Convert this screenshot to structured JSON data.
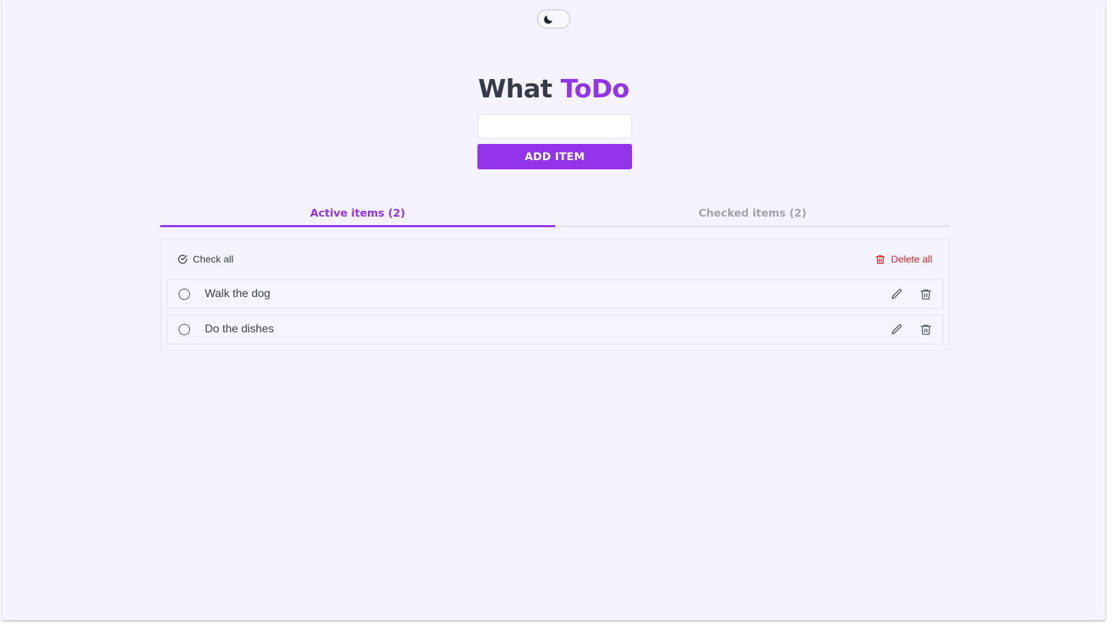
{
  "header": {
    "theme_toggle_icon": "moon-icon",
    "title_part1": "What",
    "title_part2": "ToDo"
  },
  "form": {
    "input_value": "",
    "input_placeholder": "",
    "add_label": "ADD ITEM"
  },
  "tabs": [
    {
      "label": "Active items (2)",
      "selected": true
    },
    {
      "label": "Checked items (2)",
      "selected": false
    }
  ],
  "panel": {
    "check_all_label": "Check all",
    "check_all_icon": "circle-check-icon",
    "delete_all_label": "Delete all",
    "delete_all_icon": "trash-icon"
  },
  "items": [
    {
      "text": "Walk the dog",
      "checked": false
    },
    {
      "text": "Do the dishes",
      "checked": false
    }
  ],
  "colors": {
    "accent": "#9333ea",
    "danger": "#dc2626",
    "background": "#f5f3ff",
    "text": "#353b4b",
    "muted": "#a3a3ad"
  }
}
